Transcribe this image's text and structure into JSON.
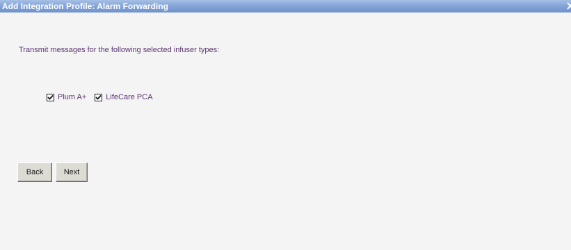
{
  "window": {
    "title": "Add Integration Profile: Alarm Forwarding",
    "close_icon": "close-icon"
  },
  "main": {
    "instruction": "Transmit messages for the following selected infuser types:",
    "infuser_types": [
      {
        "label": "Plum A+",
        "checked": true
      },
      {
        "label": "LifeCare PCA",
        "checked": true
      }
    ]
  },
  "footer": {
    "back_label": "Back",
    "next_label": "Next"
  },
  "colors": {
    "title_bar": "#86a6d8",
    "title_text": "#ffffff",
    "body_text": "#5b3470",
    "background": "#f4f4f4",
    "button_face": "#dcdcd4"
  }
}
